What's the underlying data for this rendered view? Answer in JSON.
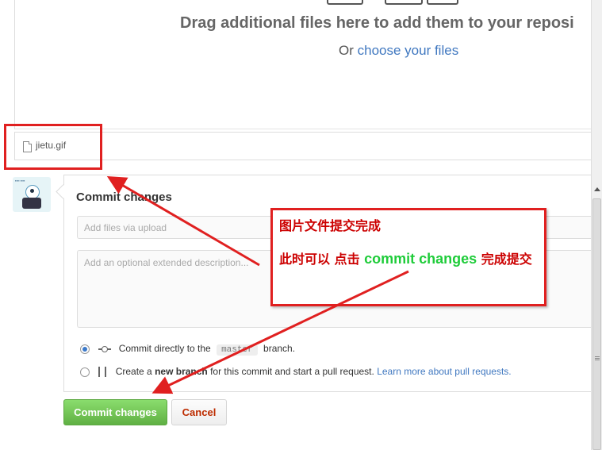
{
  "upload": {
    "drag_text": "Drag additional files here to add them to your reposi",
    "or_text": "Or",
    "choose_files_link": "choose your files"
  },
  "file": {
    "name": "jietu.gif",
    "icon": "file-icon"
  },
  "avatar": {
    "icon": "user-avatar"
  },
  "commit": {
    "title": "Commit changes",
    "summary_placeholder": "Add files via upload",
    "description_placeholder": "Add an optional extended description...",
    "option_direct": {
      "prefix": "Commit directly to the",
      "branch": "master",
      "suffix": "branch.",
      "selected": true
    },
    "option_new_branch": {
      "prefix": "Create a",
      "bold": "new branch",
      "middle": "for this commit and start a pull request.",
      "link": "Learn more about pull requests.",
      "selected": false
    },
    "commit_button": "Commit changes",
    "cancel_button": "Cancel"
  },
  "annotation": {
    "line1": "图片文件提交完成",
    "line2_prefix": "此时可以  点击  ",
    "line2_highlight": "commit changes",
    "line2_suffix": "  完成提交",
    "color_red": "#e02020",
    "color_green": "#1fcc3a"
  },
  "colors": {
    "link": "#4078c0",
    "commit_button": "#60b044",
    "cancel_text": "#bd2c00"
  }
}
